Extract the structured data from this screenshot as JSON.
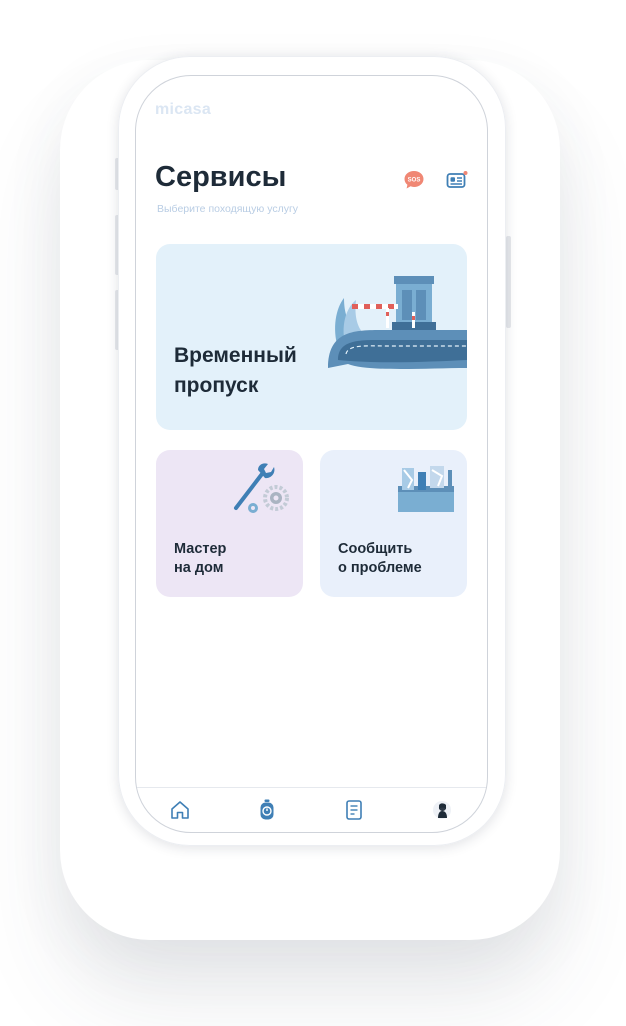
{
  "app": {
    "logo": "micasa",
    "title": "Сервисы",
    "subtitle": "Выберите походящую услугу"
  },
  "header_icons": [
    {
      "name": "sos-icon",
      "text": "SOS",
      "color": "#f08774"
    },
    {
      "name": "id-card-icon",
      "color": "#3f7fb5",
      "badge_color": "#f08774"
    }
  ],
  "services": {
    "temporary_pass": {
      "line1": "Временный",
      "line2": "пропуск",
      "icon": "barrier-gate-illustration"
    },
    "master": {
      "line1": "Мастер",
      "line2": "на дом",
      "icon": "wrench-gears-illustration"
    },
    "report": {
      "line1": "Сообщить",
      "line2": "о проблеме",
      "icon": "toolbox-illustration"
    }
  },
  "tabbar": [
    {
      "name": "home-tab",
      "icon": "home-icon"
    },
    {
      "name": "services-tab",
      "icon": "services-icon",
      "active": true
    },
    {
      "name": "documents-tab",
      "icon": "document-icon"
    },
    {
      "name": "profile-tab",
      "icon": "avatar-icon"
    }
  ],
  "colors": {
    "title": "#1e2b38",
    "accent": "#3f7fb5",
    "temp_card_bg": "#e3f1fa",
    "master_card_bg": "#ede6f5",
    "report_card_bg": "#e9f0fb"
  }
}
